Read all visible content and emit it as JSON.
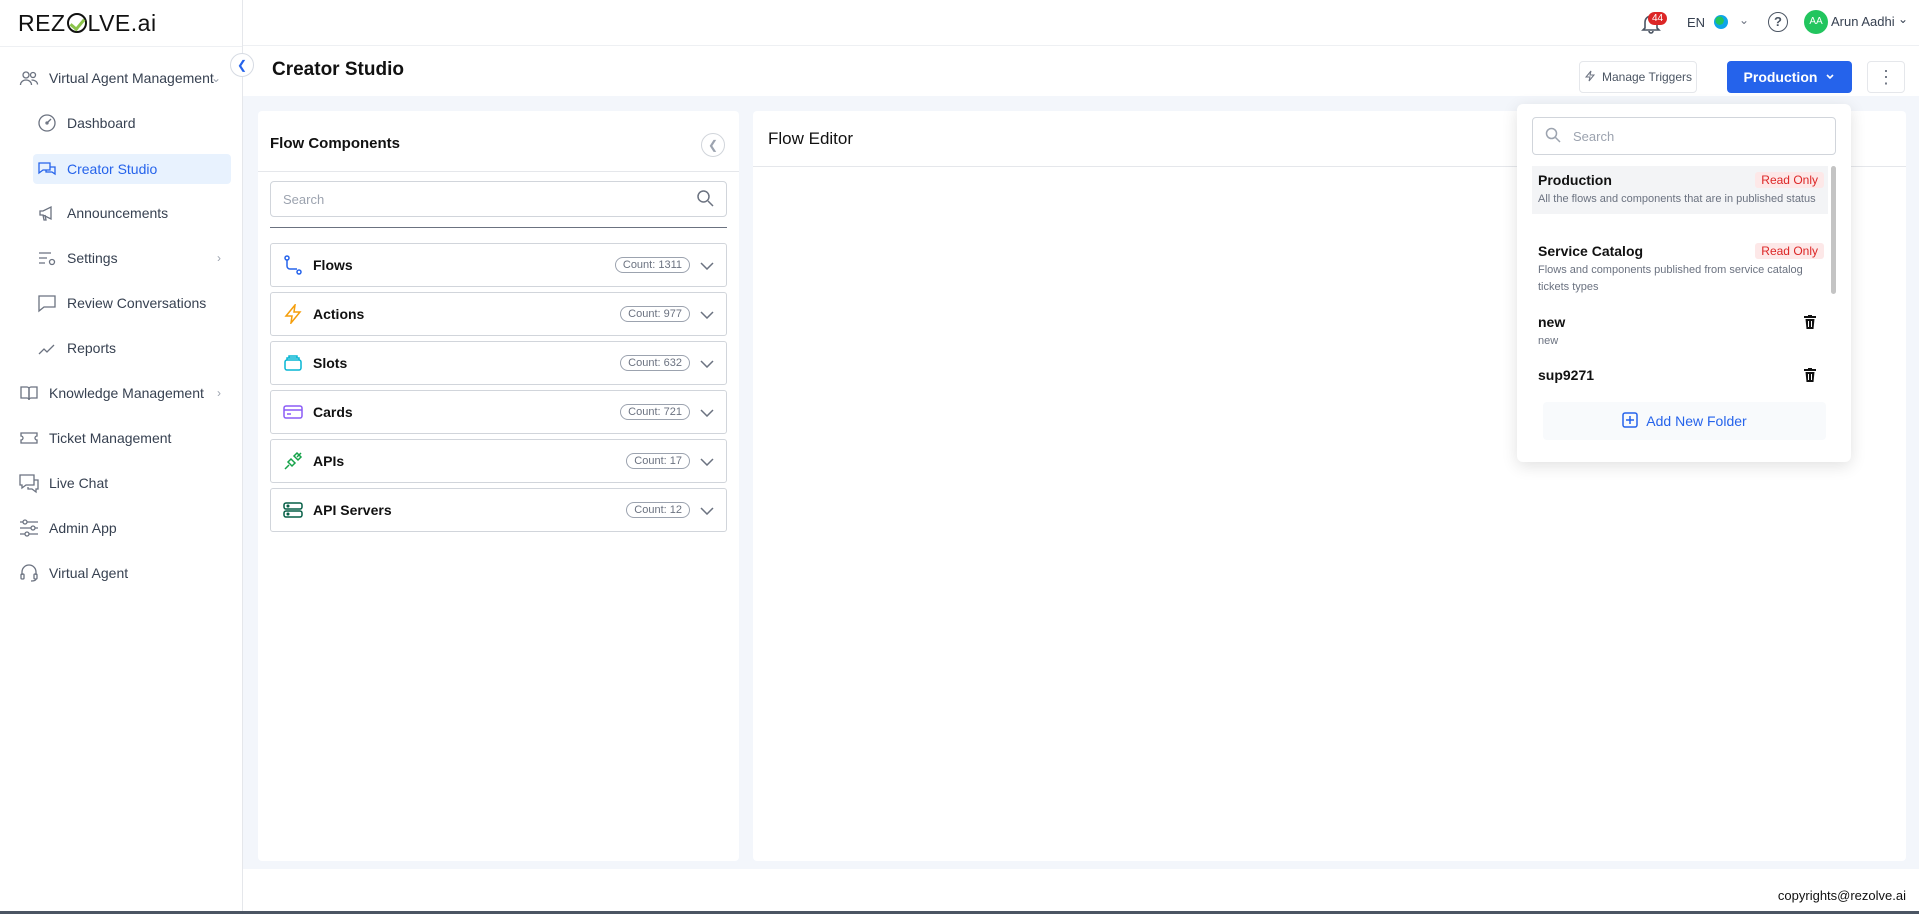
{
  "brand": {
    "logo_text_a": "REZ",
    "logo_text_b": "LVE.ai"
  },
  "sidebar": {
    "items": [
      {
        "label": "Virtual Agent Management",
        "icon": "users-icon"
      },
      {
        "label": "Dashboard",
        "icon": "gauge-icon"
      },
      {
        "label": "Creator Studio",
        "icon": "chat-bubbles-icon"
      },
      {
        "label": "Announcements",
        "icon": "megaphone-icon"
      },
      {
        "label": "Settings",
        "icon": "sliders-gear-icon"
      },
      {
        "label": "Review Conversations",
        "icon": "review-chat-icon"
      },
      {
        "label": "Reports",
        "icon": "trend-line-icon"
      },
      {
        "label": "Knowledge Management",
        "icon": "book-icon"
      },
      {
        "label": "Ticket Management",
        "icon": "ticket-icon"
      },
      {
        "label": "Live Chat",
        "icon": "live-chat-icon"
      },
      {
        "label": "Admin App",
        "icon": "admin-sliders-icon"
      },
      {
        "label": "Virtual Agent",
        "icon": "headset-icon"
      }
    ]
  },
  "topbar": {
    "notification_count": "44",
    "language": "EN",
    "user_initials": "AA",
    "user_name": "Arun Aadhi"
  },
  "header": {
    "title": "Creator Studio",
    "manage_triggers_label": "Manage Triggers",
    "environment_label": "Production"
  },
  "flow_components": {
    "title": "Flow Components",
    "search_placeholder": "Search",
    "items": [
      {
        "label": "Flows",
        "count": "Count: 1311",
        "icon": "flow-branch-icon"
      },
      {
        "label": "Actions",
        "count": "Count: 977",
        "icon": "lightning-icon"
      },
      {
        "label": "Slots",
        "count": "Count: 632",
        "icon": "slots-stack-icon"
      },
      {
        "label": "Cards",
        "count": "Count: 721",
        "icon": "card-icon"
      },
      {
        "label": "APIs",
        "count": "Count: 17",
        "icon": "api-plug-icon"
      },
      {
        "label": "API Servers",
        "count": "Count: 12",
        "icon": "server-icon"
      }
    ]
  },
  "flow_editor": {
    "title": "Flow Editor"
  },
  "env_dropdown": {
    "search_placeholder": "Search",
    "items": [
      {
        "name": "Production",
        "badge": "Read Only",
        "description": "All the flows and components that are in published status"
      },
      {
        "name": "Service Catalog",
        "badge": "Read Only",
        "description": "Flows and components published from service catalog tickets types"
      },
      {
        "name": "new",
        "description": "new"
      },
      {
        "name": "sup9271"
      }
    ],
    "add_folder_label": "Add New Folder"
  },
  "footer": {
    "copyright": "copyrights@rezolve.ai"
  },
  "colors": {
    "accent": "#2563eb",
    "badge_red": "#dc2626",
    "sidebar_active_bg": "#e8f2fe",
    "main_bg": "#f3f6fb"
  }
}
